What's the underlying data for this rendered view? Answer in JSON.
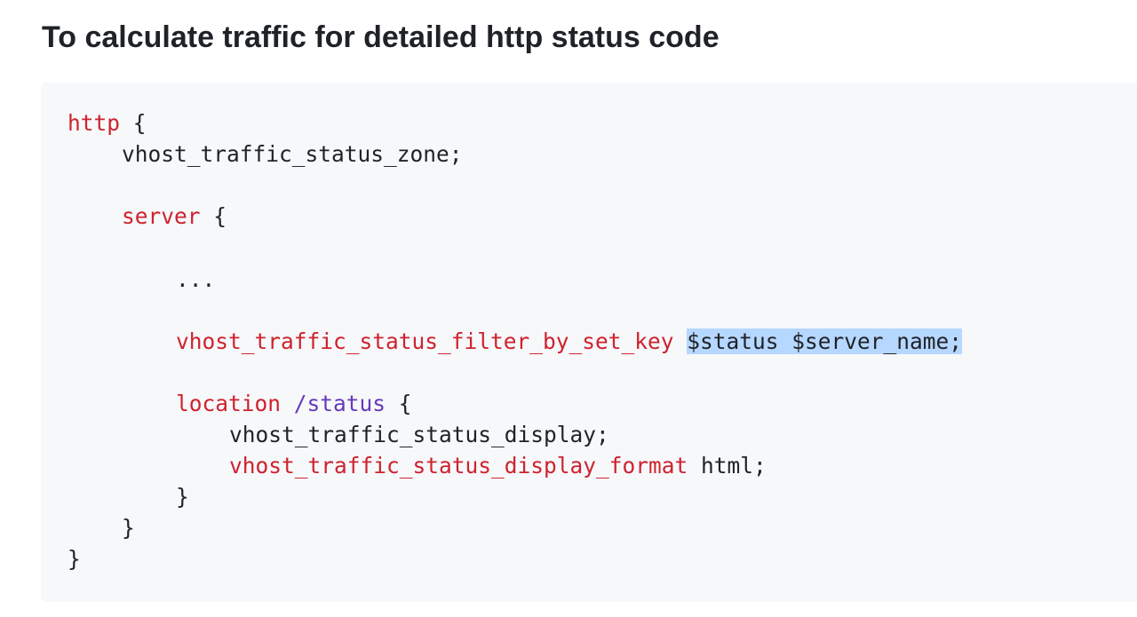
{
  "heading": "To calculate traffic for detailed http status code",
  "code": {
    "http_kw": "http",
    "http_brace": " {",
    "zone": "vhost_traffic_status_zone;",
    "server_kw": "server",
    "server_brace": " {",
    "ellipsis": "...",
    "filter_kw": "vhost_traffic_status_filter_by_set_key",
    "filter_space": " ",
    "filter_args": "$status $server_name;",
    "location_kw": "location",
    "location_space": " ",
    "location_path": "/status",
    "location_brace": " {",
    "display": "vhost_traffic_status_display;",
    "format_kw": "vhost_traffic_status_display_format",
    "format_val": " html;",
    "close_location": "}",
    "close_server": "}",
    "close_http": "}"
  },
  "colors": {
    "keyword": "#cf222e",
    "path": "#6639ba",
    "selection": "#b6d7ff",
    "code_bg": "#f6f8fa"
  }
}
